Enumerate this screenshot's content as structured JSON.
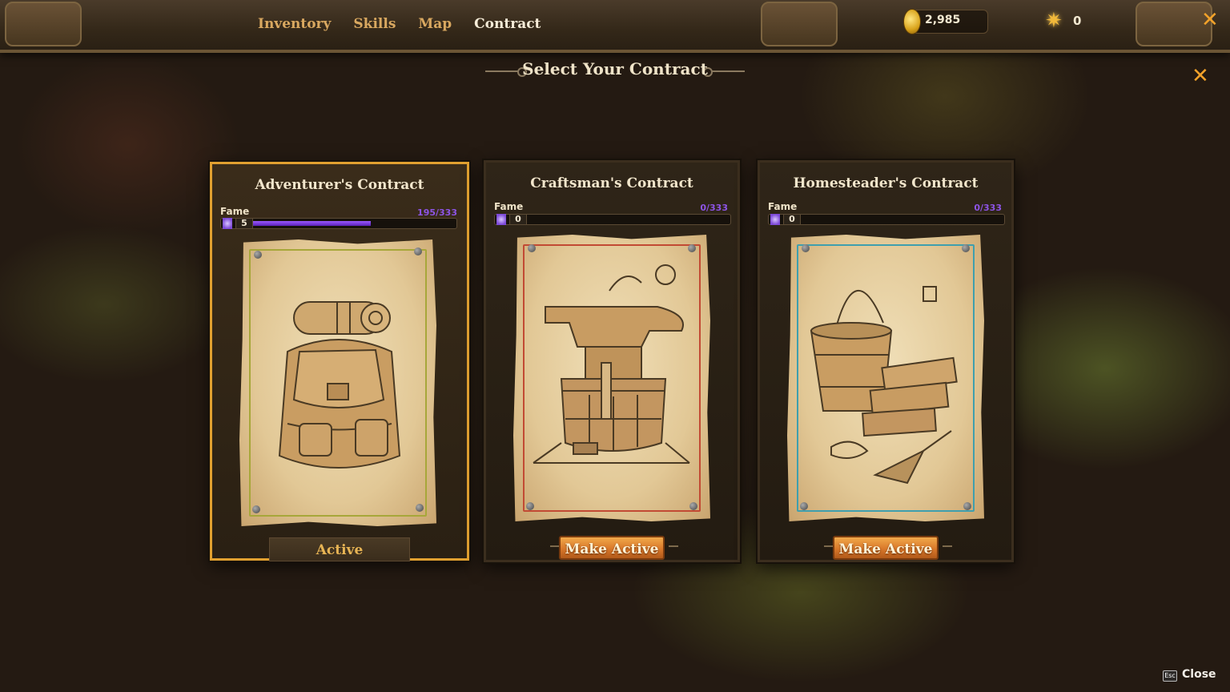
{
  "nav": {
    "tabs": [
      {
        "label": "Inventory",
        "active": false
      },
      {
        "label": "Skills",
        "active": false
      },
      {
        "label": "Map",
        "active": false
      },
      {
        "label": "Contract",
        "active": true
      }
    ]
  },
  "currency": {
    "gold": "2,985",
    "gold_icon": "gold-coin-icon",
    "stars": "0",
    "star_icon": "star-icon"
  },
  "window": {
    "close_icon": "close-icon",
    "title": "Select Your Contract"
  },
  "contracts": [
    {
      "title": "Adventurer's Contract",
      "fame_label": "Fame",
      "fame_level": "5",
      "fame_progress": "195/333",
      "fame_fraction": 0.586,
      "frame_color": "#a7a73a",
      "illustration": "backpack-sketch",
      "button_label": "Active",
      "is_active": true
    },
    {
      "title": "Craftsman's Contract",
      "fame_label": "Fame",
      "fame_level": "0",
      "fame_progress": "0/333",
      "fame_fraction": 0,
      "frame_color": "#c24a34",
      "illustration": "anvil-sketch",
      "button_label": "Make Active",
      "is_active": false
    },
    {
      "title": "Homesteader's Contract",
      "fame_label": "Fame",
      "fame_level": "0",
      "fame_progress": "0/333",
      "fame_fraction": 0,
      "frame_color": "#3f9fae",
      "illustration": "bucket-bricks-sketch",
      "button_label": "Make Active",
      "is_active": false
    }
  ],
  "footer": {
    "key": "Esc",
    "label": "Close"
  },
  "colors": {
    "accent_orange": "#f2a22a",
    "fame_purple": "#8d54e6",
    "active_border": "#e0a030"
  }
}
